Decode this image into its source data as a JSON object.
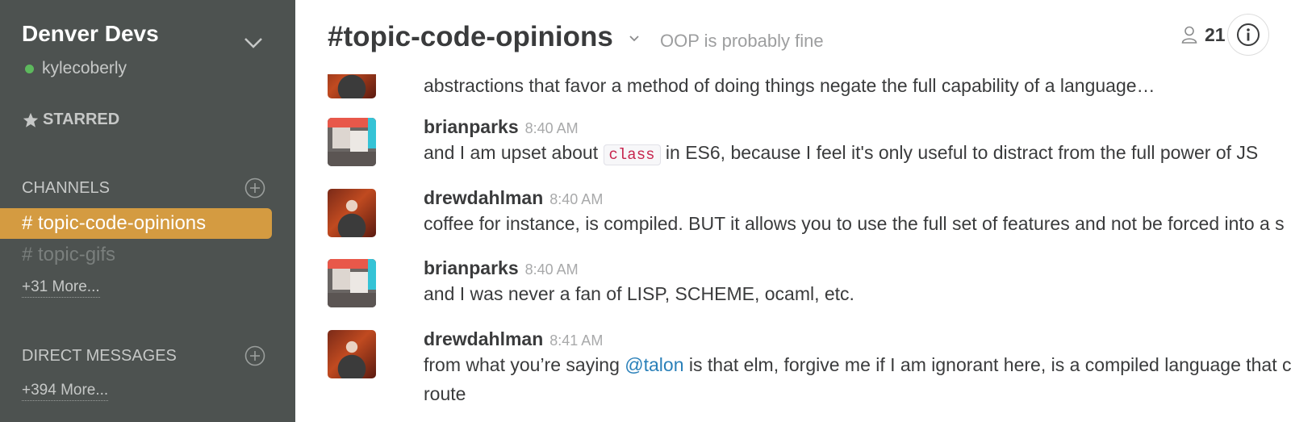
{
  "sidebar": {
    "team_name": "Denver Devs",
    "user": "kylecoberly",
    "starred_label": "STARRED",
    "channels_label": "CHANNELS",
    "channels": [
      {
        "label": "# topic-code-opinions",
        "active": true
      },
      {
        "label": "# topic-gifs",
        "active": false
      }
    ],
    "channels_more": "+31 More...",
    "dm_label": "DIRECT MESSAGES",
    "dm_more": "+394 More..."
  },
  "header": {
    "channel_title": "#topic-code-opinions",
    "topic": "OOP is probably fine",
    "member_count": "21"
  },
  "messages": [
    {
      "author": "",
      "time": "",
      "text": "abstractions that favor a method of doing things negate the full capability of a language…"
    },
    {
      "author": "brianparks",
      "time": "8:40 AM",
      "text_pre": "and I am upset about ",
      "code": "class",
      "text_post": " in ES6, because I feel it's only useful to distract from the full power of JS"
    },
    {
      "author": "drewdahlman",
      "time": "8:40 AM",
      "text": "coffee for instance, is compiled. BUT it allows you to use the full set of features and not be forced into a s"
    },
    {
      "author": "brianparks",
      "time": "8:40 AM",
      "text": "and I was never a fan of LISP, SCHEME, ocaml, etc."
    },
    {
      "author": "drewdahlman",
      "time": "8:41 AM",
      "text_pre": "from what you’re saying ",
      "mention": "@talon",
      "text_post": " is that elm, forgive me if I am ignorant here, is a compiled language that c",
      "text_line2": "route"
    }
  ],
  "colors": {
    "sidebar_bg": "#4d5250",
    "active_channel": "#d49b41",
    "presence": "#5db95d",
    "mention": "#2a80b9"
  },
  "icons": [
    "chevron-down-icon",
    "star-icon",
    "plus-circle-icon",
    "caret-down-icon",
    "member-icon",
    "info-icon"
  ]
}
